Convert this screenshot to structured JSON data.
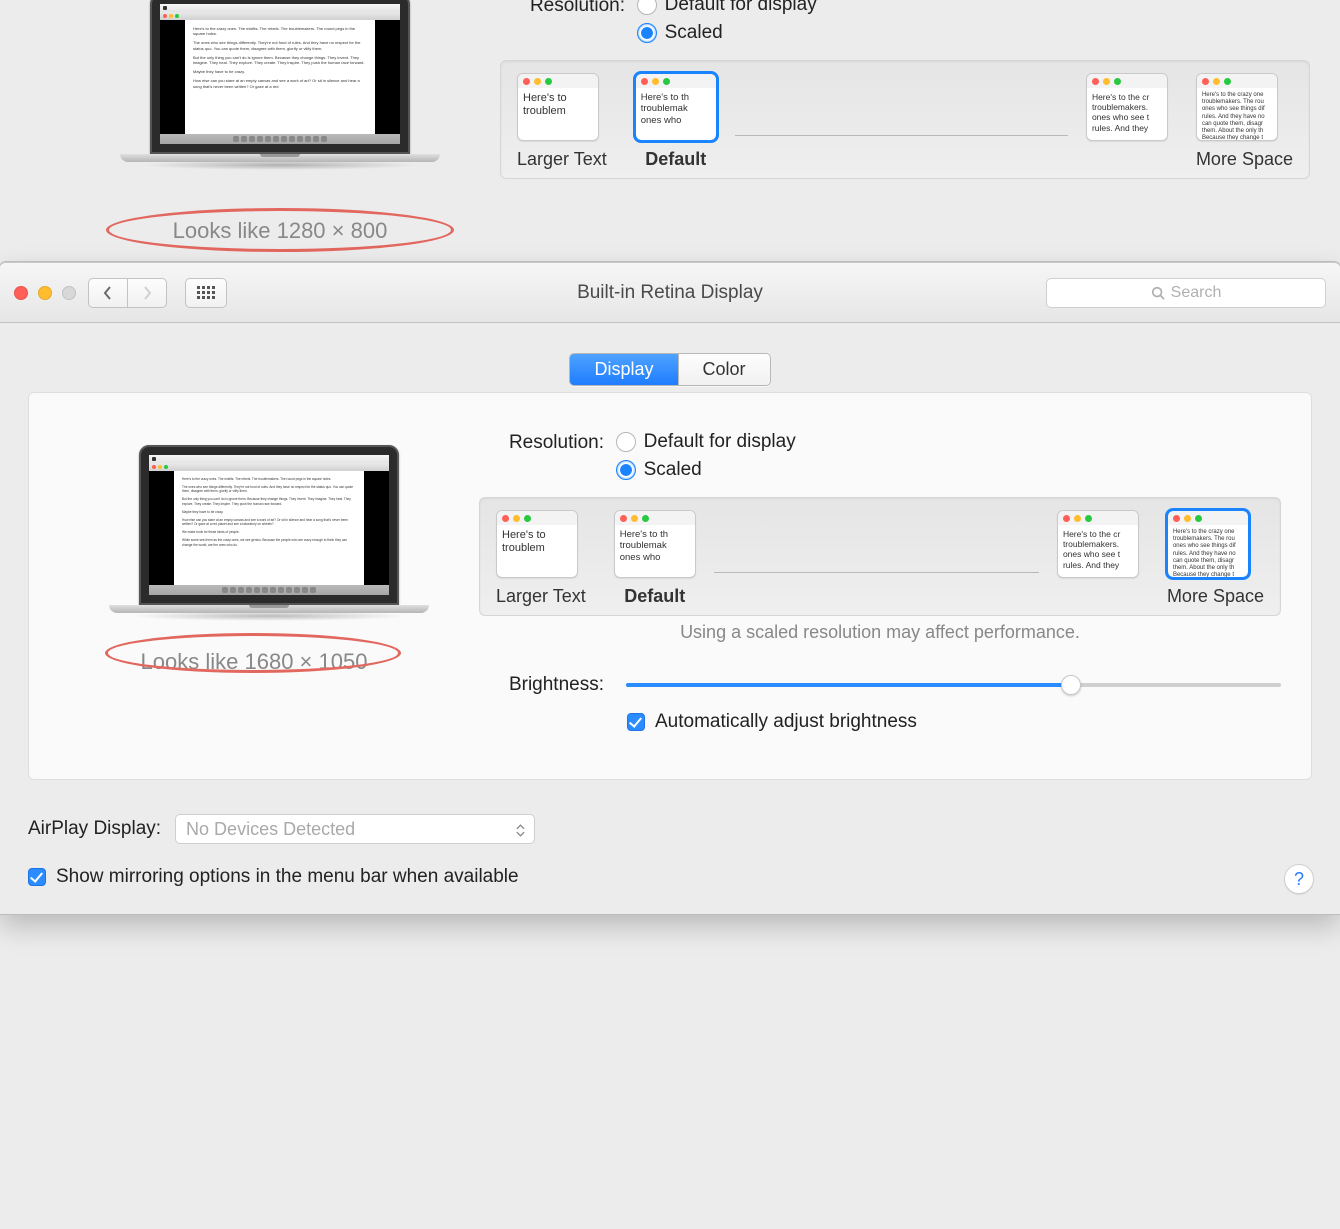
{
  "upper": {
    "resolution_label": "Resolution:",
    "radio_default": "Default for display",
    "radio_scaled": "Scaled",
    "looks_like": "Looks like 1280 × 800",
    "thumbs": {
      "larger": "Larger Text",
      "default": "Default",
      "more_space": "More Space",
      "sample_large": "Here's to\ntroublem",
      "sample_default": "Here's to th troublemak ones who",
      "sample_mid": "Here's to the cr troublemakers. ones who see t rules. And they",
      "sample_small": "Here's to the crazy one troublemakers. The rou ones who see things dif rules. And they have no can quote them, disagr them. About the only th Because they change t"
    }
  },
  "window": {
    "title": "Built-in Retina Display",
    "search_placeholder": "Search",
    "tabs": {
      "display": "Display",
      "color": "Color"
    },
    "resolution_label": "Resolution:",
    "radio_default": "Default for display",
    "radio_scaled": "Scaled",
    "looks_like": "Looks like 1680 × 1050",
    "warn": "Using a scaled resolution may affect performance.",
    "thumbs": {
      "larger": "Larger Text",
      "default": "Default",
      "more_space": "More Space"
    },
    "brightness_label": "Brightness:",
    "auto_brightness": "Automatically adjust brightness",
    "airplay_label": "AirPlay Display:",
    "airplay_value": "No Devices Detected",
    "mirroring": "Show mirroring options in the menu bar when available",
    "help": "?"
  }
}
